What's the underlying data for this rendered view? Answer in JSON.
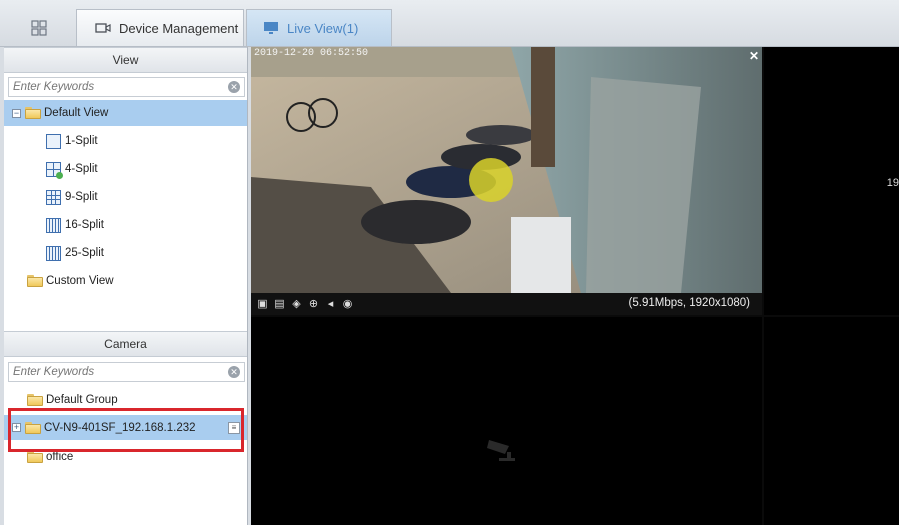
{
  "tabs": {
    "home_icon": "grid-icon",
    "device_management": "Device Management",
    "device_icon": "camera-icon",
    "live_view": "Live View(1)",
    "live_icon": "monitor-icon"
  },
  "view_panel": {
    "title": "View",
    "search_placeholder": "Enter Keywords",
    "items": [
      {
        "label": "Default View",
        "icon": "folder-icon",
        "selected": true
      },
      {
        "label": "1-Split",
        "icon": "split-1-icon"
      },
      {
        "label": "4-Split",
        "icon": "split-4-icon"
      },
      {
        "label": "9-Split",
        "icon": "split-9-icon"
      },
      {
        "label": "16-Split",
        "icon": "split-16-icon"
      },
      {
        "label": "25-Split",
        "icon": "split-25-icon"
      },
      {
        "label": "Custom View",
        "icon": "folder-icon"
      }
    ]
  },
  "camera_panel": {
    "title": "Camera",
    "search_placeholder": "Enter Keywords",
    "items": [
      {
        "label": "Default Group",
        "icon": "folder-icon"
      },
      {
        "label": "CV-N9-401SF_192.168.1.232",
        "icon": "folder-icon",
        "selected": true
      },
      {
        "label": "office",
        "icon": "folder-icon"
      }
    ]
  },
  "live": {
    "timestamp": "2019-12-20 06:52:50",
    "bitrate": "(5.91Mbps, 1920x1080)",
    "side_text": "19",
    "controls": [
      "snapshot-icon",
      "record-icon",
      "ptz-icon",
      "zoom-icon",
      "audio-icon",
      "playback-icon"
    ]
  }
}
